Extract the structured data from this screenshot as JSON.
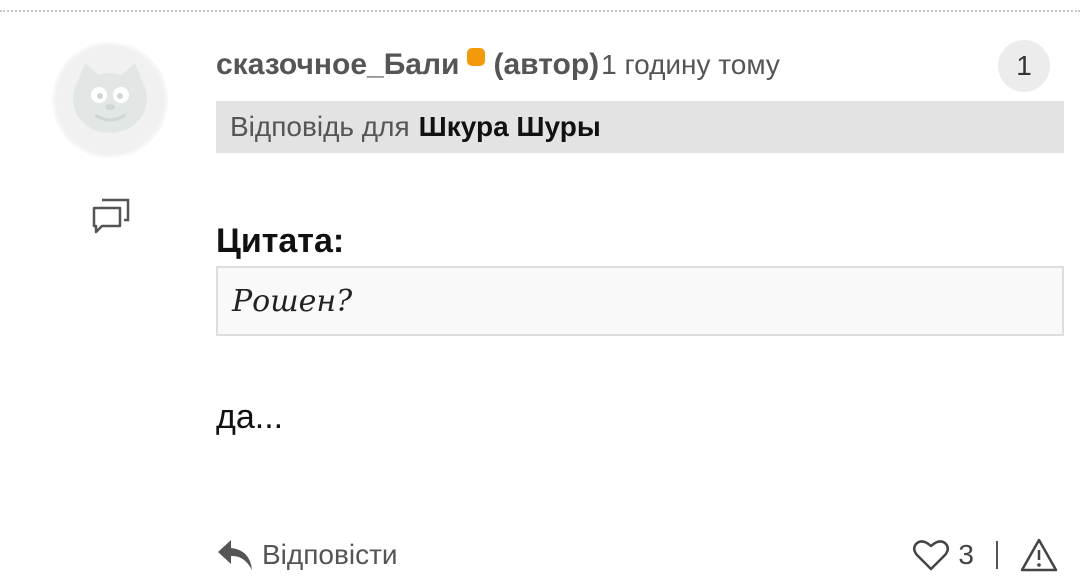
{
  "comment": {
    "author": "сказочное_Бали",
    "author_tag": "(автор)",
    "timestamp": "1 годину тому",
    "vote_count": "1",
    "reply_to": {
      "prefix": "Відповідь для",
      "name": "Шкура Шуры"
    },
    "quote_label": "Цитата:",
    "quote_text": "Рошен?",
    "body": "да..."
  },
  "actions": {
    "reply_label": "Відповісти",
    "like_count": "3"
  },
  "icons": {
    "avatar": "cat-avatar",
    "thread": "conversation-icon",
    "reply": "reply-arrow-icon",
    "like": "heart-icon",
    "report": "warning-triangle-icon"
  },
  "colors": {
    "online_indicator": "#f39a0b",
    "reply_bar": "#e3e3e3",
    "quote_background": "#f9f9f9"
  }
}
